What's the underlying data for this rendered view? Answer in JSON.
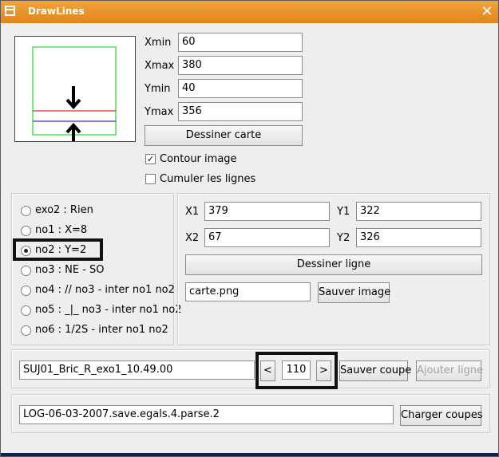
{
  "window": {
    "title": "DrawLines",
    "close_glyph": "✕"
  },
  "bounds": {
    "xmin_label": "Xmin",
    "xmin_value": "60",
    "xmax_label": "Xmax",
    "xmax_value": "380",
    "ymin_label": "Ymin",
    "ymin_value": "40",
    "ymax_label": "Ymax",
    "ymax_value": "356",
    "draw_map_label": "Dessiner carte"
  },
  "options": {
    "contour_label": "Contour image",
    "contour_checked": true,
    "cumulate_label": "Cumuler les lignes",
    "cumulate_checked": false
  },
  "radio_list": [
    {
      "label": "exo2 : Rien",
      "selected": false
    },
    {
      "label": "no1 : X=8",
      "selected": false
    },
    {
      "label": "no2 : Y=2",
      "selected": true
    },
    {
      "label": "no3 : NE - SO",
      "selected": false
    },
    {
      "label": "no4 : // no3 - inter no1 no2",
      "selected": false
    },
    {
      "label": "no5 : _|_ no3 - inter no1 no2",
      "selected": false
    },
    {
      "label": "no6 : 1/2S - inter no1 no2",
      "selected": false
    }
  ],
  "line": {
    "x1_label": "X1",
    "x1_value": "379",
    "y1_label": "Y1",
    "y1_value": "322",
    "x2_label": "X2",
    "x2_value": "67",
    "y2_label": "Y2",
    "y2_value": "326",
    "draw_line_label": "Dessiner ligne",
    "filename_value": "carte.png",
    "save_image_label": "Sauver image"
  },
  "cut": {
    "name_value": "SUJ01_Bric_R_exo1_10.49.00",
    "prev_label": "<",
    "index_value": "110",
    "next_label": ">",
    "save_cut_label": "Sauver coupe",
    "add_line_label": "Ajouter ligne"
  },
  "log": {
    "file_value": "LOG-06-03-2007.save.egals.4.parse.2",
    "load_cuts_label": "Charger coupes"
  },
  "colors": {
    "title_bar": "#e8921f",
    "frame_green": "#00cc00",
    "line_red": "#cc0000",
    "line_blue": "#0000cc",
    "taskbar": "#0b2457"
  },
  "icons": [
    "window-menu-icon",
    "close-icon",
    "down-arrow-icon",
    "up-arrow-icon"
  ]
}
